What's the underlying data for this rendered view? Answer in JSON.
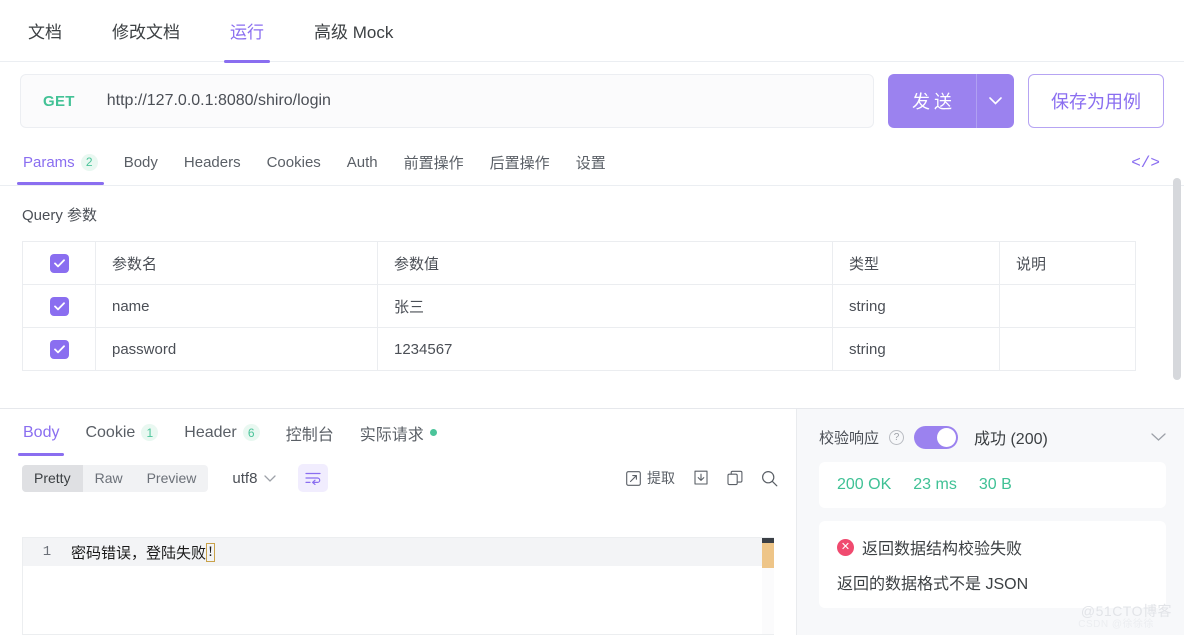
{
  "top_tabs": [
    {
      "label": "文档",
      "active": false
    },
    {
      "label": "修改文档",
      "active": false
    },
    {
      "label": "运行",
      "active": true
    },
    {
      "label": "高级 Mock",
      "active": false
    }
  ],
  "url_bar": {
    "method": "GET",
    "url": "http://127.0.0.1:8080/shiro/login",
    "send_label": "发送",
    "send_caret_icon": "chevron-down-icon",
    "save_label": "保存为用例"
  },
  "request_tabs": [
    {
      "label": "Params",
      "badge": "2",
      "active": true
    },
    {
      "label": "Body",
      "badge": "",
      "active": false
    },
    {
      "label": "Headers",
      "badge": "",
      "active": false
    },
    {
      "label": "Cookies",
      "badge": "",
      "active": false
    },
    {
      "label": "Auth",
      "badge": "",
      "active": false
    },
    {
      "label": "前置操作",
      "badge": "",
      "active": false
    },
    {
      "label": "后置操作",
      "badge": "",
      "active": false
    },
    {
      "label": "设置",
      "badge": "",
      "active": false
    }
  ],
  "code_icon": "code-brackets-icon",
  "params": {
    "title": "Query 参数",
    "header": {
      "checked": true,
      "name_placeholder": "参数名",
      "value_placeholder": "参数值",
      "type_placeholder": "类型",
      "desc_placeholder": "说明"
    },
    "rows": [
      {
        "checked": true,
        "name": "name",
        "value": "张三",
        "type": "string",
        "desc": ""
      },
      {
        "checked": true,
        "name": "password",
        "value": "1234567",
        "type": "string",
        "desc": ""
      }
    ]
  },
  "response": {
    "tabs": [
      {
        "label": "Body",
        "badge": "",
        "dot": false,
        "active": true
      },
      {
        "label": "Cookie",
        "badge": "1",
        "dot": false,
        "active": false
      },
      {
        "label": "Header",
        "badge": "6",
        "dot": false,
        "active": false
      },
      {
        "label": "控制台",
        "badge": "",
        "dot": false,
        "active": false
      },
      {
        "label": "实际请求",
        "badge": "",
        "dot": true,
        "active": false
      }
    ],
    "toolbar": {
      "views": [
        {
          "label": "Pretty",
          "active": true
        },
        {
          "label": "Raw",
          "active": false
        },
        {
          "label": "Preview",
          "active": false
        }
      ],
      "encoding": "utf8",
      "encoding_caret_icon": "chevron-down-icon",
      "wrap_icon": "text-wrap-icon",
      "extract_label": "提取",
      "extract_icon": "extract-icon",
      "download_icon": "download-icon",
      "copy_icon": "copy-icon",
      "search_icon": "search-icon"
    },
    "body": {
      "line_number": "1",
      "text": "密码错误，登陆失败",
      "highlight": "!"
    }
  },
  "verify": {
    "label": "校验响应",
    "help_icon": "help-circle-icon",
    "toggle_on": true,
    "status": "成功 (200)",
    "collapse_icon": "chevron-down-icon",
    "stats": [
      "200 OK",
      "23 ms",
      "30 B"
    ],
    "error": {
      "icon": "error-circle-icon",
      "title": "返回数据结构校验失败",
      "detail": "返回的数据格式不是 JSON"
    }
  },
  "watermarks": {
    "primary": "@51CTO博客",
    "secondary": "CSDN @徐徐徐"
  },
  "colors": {
    "accent": "#8a6ef0",
    "success": "#43c296",
    "error": "#f04a6f"
  }
}
